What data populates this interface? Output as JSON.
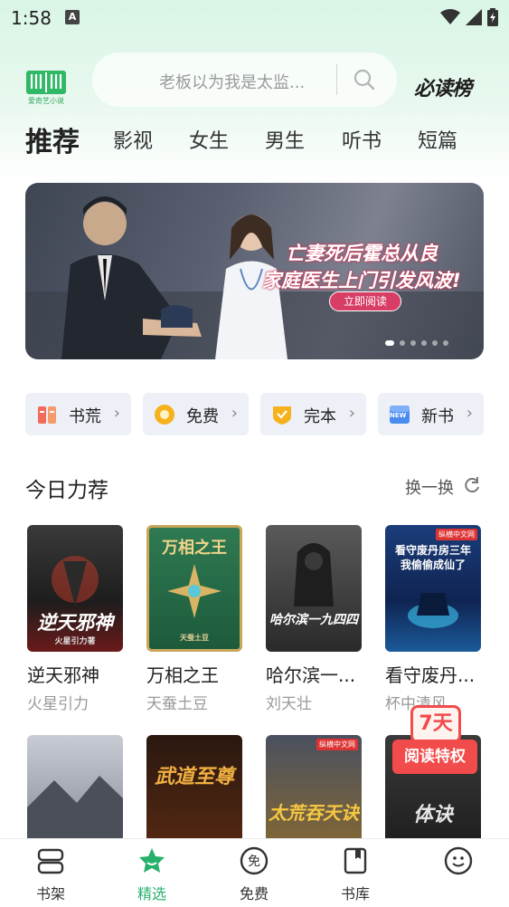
{
  "status_bar": {
    "time": "1:58",
    "notification_icon_letter": "A",
    "icons": [
      "wifi-icon",
      "signal-icon",
      "battery-icon"
    ]
  },
  "header": {
    "app_logo_label": "爱奇艺小说",
    "search_placeholder": "老板以为我是太监...",
    "rank_link": "必读榜"
  },
  "tabs": [
    {
      "label": "推荐",
      "active": true
    },
    {
      "label": "影视",
      "active": false
    },
    {
      "label": "女生",
      "active": false
    },
    {
      "label": "男生",
      "active": false
    },
    {
      "label": "听书",
      "active": false
    },
    {
      "label": "短篇",
      "active": false
    }
  ],
  "banner": {
    "headline_line1": "亡妻死后霍总从良",
    "headline_line2": "家庭医生上门引发风波!",
    "cta": "立即阅读",
    "slide_count": 6,
    "active_slide": 1
  },
  "chips": [
    {
      "label": "书荒",
      "icon": "book-shortage-icon",
      "color": "#f26a5a"
    },
    {
      "label": "免费",
      "icon": "coin-icon",
      "color": "#f5b21c"
    },
    {
      "label": "完本",
      "icon": "shield-check-icon",
      "color": "#f5b21c"
    },
    {
      "label": "新书",
      "icon": "new-book-icon",
      "color": "#4a8cf0",
      "icon_text": "NEW"
    }
  ],
  "section": {
    "title": "今日力荐",
    "refresh_label": "换一换"
  },
  "books_row1": [
    {
      "title": "逆天邪神",
      "author": "火星引力",
      "cover_text": "逆天邪神",
      "cover_sub": "火星引力著"
    },
    {
      "title": "万相之王",
      "author": "天蚕土豆",
      "cover_text": "万相之王",
      "cover_sub": "天蚕土豆"
    },
    {
      "title": "哈尔滨一...",
      "author": "刘天壮",
      "cover_text": "哈尔滨一九四四"
    },
    {
      "title": "看守废丹...",
      "author": "杯中清风",
      "cover_text": "看守废丹房三年 我偷偷成仙了",
      "cover_badge": "纵横中文网"
    }
  ],
  "books_row2": [
    {
      "cover_text": ""
    },
    {
      "cover_text": "武道至尊"
    },
    {
      "cover_text": "太荒吞天诀",
      "cover_badge": "纵横中文网"
    },
    {
      "cover_text": "体诀"
    }
  ],
  "promo": {
    "top": "7天",
    "bottom": "阅读特权"
  },
  "bottom_nav": [
    {
      "label": "书架",
      "icon": "bookshelf-icon",
      "active": false
    },
    {
      "label": "精选",
      "icon": "featured-star-icon",
      "active": true
    },
    {
      "label": "免费",
      "icon": "free-icon",
      "active": false,
      "icon_text": "免"
    },
    {
      "label": "书库",
      "icon": "library-icon",
      "active": false
    },
    {
      "label": "",
      "icon": "profile-face-icon",
      "active": false
    }
  ],
  "colors": {
    "accent": "#27b06b",
    "chip_bg": "#edf0f6",
    "promo_red": "#f24b4b"
  }
}
